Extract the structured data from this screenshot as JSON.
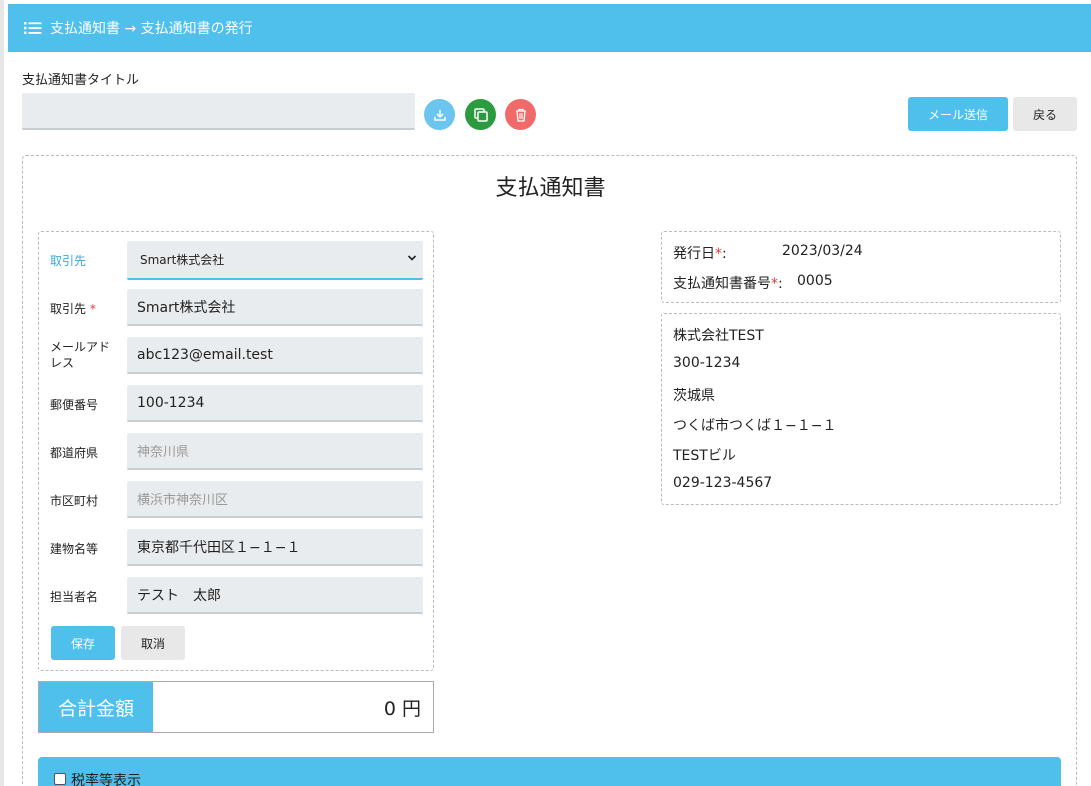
{
  "header": {
    "breadcrumb": "支払通知書 → 支払通知書の発行",
    "icon": "list-icon"
  },
  "title_section": {
    "label": "支払通知書タイトル",
    "value": "",
    "icons": [
      "download-icon",
      "copy-icon",
      "trash-icon"
    ]
  },
  "actions": {
    "mail_label": "メール送信",
    "back_label": "戻る"
  },
  "document": {
    "title": "支払通知書"
  },
  "vendor_form": {
    "select_label": "取引先",
    "select_value": "Smart株式会社",
    "fields": [
      {
        "label": "取引先",
        "required": true,
        "value": "Smart株式会社"
      },
      {
        "label_line1": "メールアド",
        "label_line2": "レス",
        "value": "abc123@email.test"
      },
      {
        "label": "郵便番号",
        "value": "100-1234"
      },
      {
        "label": "都道府県",
        "placeholder": "神奈川県"
      },
      {
        "label": "市区町村",
        "placeholder": "横浜市神奈川区"
      },
      {
        "label": "建物名等",
        "value": "東京都千代田区１−１−１"
      },
      {
        "label": "担当者名",
        "value": "テスト　太郎"
      }
    ],
    "save_label": "保存",
    "cancel_label": "取消"
  },
  "total": {
    "label": "合計金額",
    "value": "0 円"
  },
  "issue_info": {
    "date_label": "発行日",
    "date_value": "2023/03/24",
    "number_label": "支払通知書番号",
    "number_value": "0005",
    "required_mark": "*",
    "colon": ":"
  },
  "issuer": {
    "lines": [
      "株式会社TEST",
      "300-1234",
      "茨城県",
      "つくば市つくば１−１−１",
      "TESTビル",
      "029-123-4567"
    ]
  },
  "tax_section": {
    "label": "税率等表示",
    "checked": false
  },
  "colors": {
    "accent": "#4fbfec",
    "copy": "#2c9a3f",
    "delete": "#f06a6a",
    "required": "#e53935"
  }
}
